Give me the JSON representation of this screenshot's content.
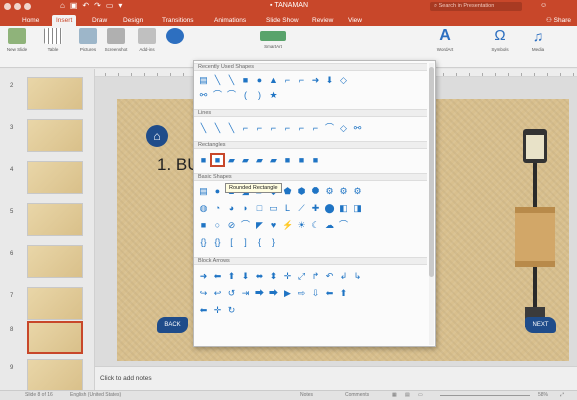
{
  "window": {
    "title": "TANAMAN",
    "search_placeholder": "Search in Presentation"
  },
  "tabs": [
    "Home",
    "Insert",
    "Draw",
    "Design",
    "Transitions",
    "Animations",
    "Slide Show",
    "Review",
    "View"
  ],
  "active_tab": "Insert",
  "share_label": "Share",
  "ribbon": {
    "new_slide": "New Slide",
    "table": "Table",
    "pictures": "Pictures",
    "screenshot": "Screenshot",
    "add_ins": "Add-ins",
    "smartart": "SmartArt",
    "wordart": "WordArt",
    "symbols": "Symbols",
    "media": "Media"
  },
  "thumbnails": [
    "2",
    "3",
    "4",
    "5",
    "6",
    "7",
    "8",
    "9"
  ],
  "selected_thumbnail": "8",
  "slide": {
    "title": "1. BU",
    "back_label": "BACK",
    "next_label": "NEXT"
  },
  "notes_placeholder": "Click to add notes",
  "status": {
    "slide_info": "Slide 8 of 16",
    "language": "English (United States)",
    "notes_btn": "Notes",
    "comments_btn": "Comments",
    "zoom": "58%"
  },
  "shapes_menu": {
    "sections": {
      "recent": "Recently Used Shapes",
      "lines": "Lines",
      "rectangles": "Rectangles",
      "basic": "Basic Shapes",
      "block_arrows": "Block Arrows"
    },
    "recent_row1": [
      "▤",
      "╲",
      "╲",
      "■",
      "●",
      "▲",
      "⌐",
      "⌐",
      "➜",
      "⬇",
      "◇"
    ],
    "recent_row2": [
      "⚯",
      "⌒",
      "⌒",
      "(",
      ")",
      "★"
    ],
    "lines_row": [
      "╲",
      "╲",
      "╲",
      "⌐",
      "⌐",
      "⌐",
      "⌐",
      "⌐",
      "⌐",
      "⌒",
      "◇",
      "⚯"
    ],
    "rect_row": [
      "■",
      "■",
      "▰",
      "▰",
      "▰",
      "▰",
      "■",
      "■",
      "■"
    ],
    "basic_row1": [
      "▤",
      "●",
      "▲",
      "◢",
      "▱",
      "◆",
      "⬟",
      "⬢",
      "⯃",
      "⚙",
      "⚙",
      "⚙"
    ],
    "basic_row2": [
      "◍",
      "◔",
      "◕",
      "◗",
      "□",
      "▭",
      "L",
      "⟋",
      "✚",
      "⬤",
      "◧",
      "◨"
    ],
    "basic_row3": [
      "■",
      "○",
      "⊘",
      "⌒",
      "◤",
      "♥",
      "⚡",
      "☀",
      "☾",
      "☁",
      "⌒"
    ],
    "basic_row4": [
      "{}",
      "{}",
      "[",
      "]",
      "{",
      "}"
    ],
    "arrows_row1": [
      "➜",
      "⬅",
      "⬆",
      "⬇",
      "⬌",
      "⬍",
      "✛",
      "⤢",
      "↱",
      "↶",
      "↲",
      "↳"
    ],
    "arrows_row2": [
      "↪",
      "↩",
      "↺",
      "⇥",
      "⮕",
      "⮕",
      "▶",
      "⇨",
      "⇩",
      "⬅",
      "⬆"
    ],
    "arrows_row3": [
      "⬅",
      "✛",
      "↻"
    ],
    "tooltip": "Rounded Rectangle"
  },
  "colors": {
    "accent": "#c8472a",
    "shape_blue": "#1f74c4",
    "slide_bg": "#d8bf8d",
    "nav_blue": "#1f4c8a"
  }
}
